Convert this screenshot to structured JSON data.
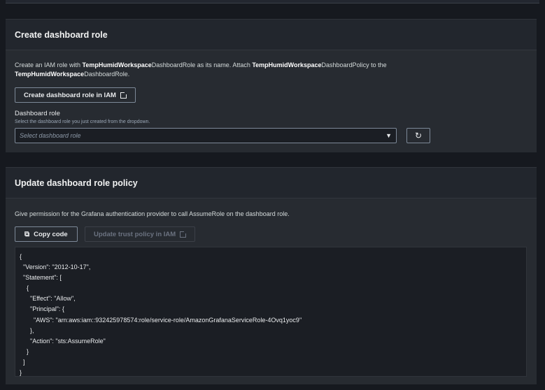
{
  "create_role": {
    "title": "Create dashboard role",
    "desc": {
      "p1": "Create an IAM role with ",
      "b1": "TempHumidWorkspace",
      "p2": "DashboardRole as its name. Attach ",
      "b2": "TempHumidWorkspace",
      "p3": "DashboardPolicy to the ",
      "b3": "TempHumidWorkspace",
      "p4": "DashboardRole."
    },
    "button_label": "Create dashboard role in IAM",
    "field_label": "Dashboard role",
    "field_hint": "Select the dashboard role you just created from the dropdown.",
    "select_placeholder": "Select dashboard role"
  },
  "update_policy": {
    "title": "Update dashboard role policy",
    "desc": "Give permission for the Grafana authentication provider to call AssumeRole on the dashboard role.",
    "copy_label": "Copy code",
    "update_label": "Update trust policy in IAM",
    "code": "{\n  \"Version\": \"2012-10-17\",\n  \"Statement\": [\n    {\n      \"Effect\": \"Allow\",\n      \"Principal\": {\n        \"AWS\": \"arn:aws:iam::932425978574:role/service-role/AmazonGrafanaServiceRole-4Ovq1yoc9\"\n      },\n      \"Action\": \"sts:AssumeRole\"\n    }\n  ]\n}"
  }
}
